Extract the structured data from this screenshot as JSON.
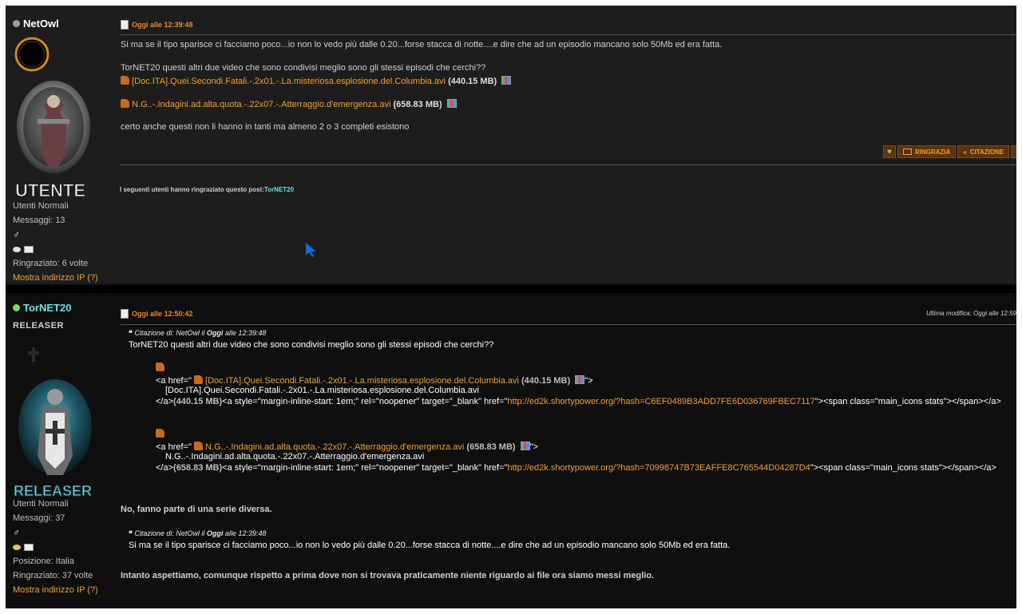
{
  "posts": [
    {
      "user": {
        "name": "NetOwl",
        "status_color": "#9e9e9e",
        "name_color": "#ffffff",
        "rank_image_text": "UTENTE",
        "group": "Utenti Normali",
        "messages": "Messaggi: 13",
        "thanked": "Ringraziato: 6 volte",
        "ip_link": "Mostra indirizzo IP (?)"
      },
      "time": "Oggi alle 12:39:48",
      "body": {
        "line1": "Si ma se il tipo sparisce ci facciamo poco...io non lo vedo più dalle 0.20...forse stacca di notte....e dire che ad un episodio mancano solo 50Mb ed era fatta.",
        "line2": "TorNET20 questi altri due video che sono condivisi meglio sono gli stessi episodi che cerchi??",
        "file1_name": "[Doc.ITA].Quei.Secondi.Fatali.-.2x01.-.La.misteriosa.esplosione.del.Columbia.avi",
        "file1_size": "(440.15 MB)",
        "file2_name": "N.G..-.Indagini.ad.alta.quota.-.22x07.-.Atterraggio.d'emergenza.avi",
        "file2_size": "(658.83 MB)",
        "line3": "certo anche questi non li hanno in tanti ma almeno 2 o 3 completi esistono"
      },
      "buttons": {
        "thank": "RINGRAZIA",
        "quote": "CITAZIONE"
      },
      "thanks_label": "I seguenti utenti hanno ringraziato questo post:",
      "thanks_user": "TorNET20"
    },
    {
      "user": {
        "name": "TorNET20",
        "status_color": "#7ed957",
        "name_color": "#66e0e0",
        "title": "RELEASER",
        "rank_image_text": "RELEASER",
        "group": "Utenti Normali",
        "messages": "Messaggi: 37",
        "position": "Posizione: Italia",
        "thanked": "Ringraziato: 37 volte",
        "ip_link": "Mostra indirizzo IP (?)"
      },
      "time": "Oggi alle 12:50:42",
      "last_edit_label": "Ultima modifica:",
      "last_edit_time": "Oggi alle 12:59",
      "quote1": {
        "by": "Citazione di: NetOwl il",
        "day": "Oggi",
        "time": "alle 12:39:48",
        "text": "TorNET20 questi altri due video che sono condivisi meglio sono gli stessi episodi che cerchi??"
      },
      "code1": {
        "a_open": "<a href=\"",
        "file_name": "[Doc.ITA].Quei.Secondi.Fatali.-.2x01.-.La.misteriosa.esplosione.del.Columbia.avi",
        "file_size": "(440.15 MB)",
        "after_stats": "\">",
        "inner_name": "[Doc.ITA].Quei.Secondi.Fatali.-.2x01.-.La.misteriosa.esplosione.del.Columbia.avi",
        "close_a": "</a>",
        "size_again": "(440.15 MB)",
        "attrs": "<a style=\"margin-inline-start: 1em;\" rel=\"noopener\" target=\"_blank\" href=\"",
        "url": "http://ed2k.shortypower.org/?hash=C6EF0489B3ADD7FE6D036769FBEC7117",
        "tail": "\"><span class=\"main_icons stats\"></span></a>"
      },
      "code2": {
        "a_open": "<a href=\"",
        "file_name": "N.G..-.Indagini.ad.alta.quota.-.22x07.-.Atterraggio.d'emergenza.avi",
        "file_size": "(658.83 MB)",
        "after_stats": "\">",
        "inner_name": "N.G..-.Indagini.ad.alta.quota.-.22x07.-.Atterraggio.d'emergenza.avi",
        "close_a": "</a>",
        "size_again": "(658.83 MB)",
        "attrs": "<a style=\"margin-inline-start: 1em;\" rel=\"noopener\" target=\"_blank\" href=\"",
        "url": "http://ed2k.shortypower.org/?hash=70998747B73EAFFE8C765544D04287D4",
        "tail": "\"><span class=\"main_icons stats\"></span></a>"
      },
      "reply1": "No, fanno parte di una serie diversa.",
      "quote2": {
        "by": "Citazione di: NetOwl il",
        "day": "Oggi",
        "time": "alle 12:39:48",
        "text": "Si ma se il tipo sparisce ci facciamo poco...io non lo vedo più dalle 0.20...forse stacca di notte....e dire che ad un episodio mancano solo 50Mb ed era fatta."
      },
      "reply2": "Intanto aspettiamo, comunque rispetto a prima dove non si trovava praticamente niente riguardo ai file ora siamo messi meglio."
    }
  ],
  "colors": {
    "accent": "#f0a030",
    "link_cyan": "#66e0e0"
  }
}
